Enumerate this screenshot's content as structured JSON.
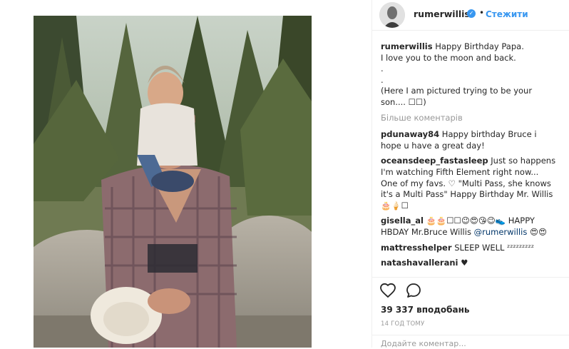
{
  "post": {
    "username": "rumerwillis",
    "verified_glyph": "✓",
    "separator": "•",
    "follow_label": "Стежити"
  },
  "caption": {
    "user": "rumerwillis",
    "text": "Happy Birthday Papa.\nI love you to the moon and back.\n.\n.\n(Here I am pictured trying to be your son.... ☐☐)"
  },
  "more_comments_label": "Більше коментарів",
  "comments": [
    {
      "user": "pdunaway84",
      "text": "Happy birthday Bruce i hope u have a great day!",
      "mention": ""
    },
    {
      "user": "oceansdeep_fastasleep",
      "text": "Just so happens I'm watching Fifth Element right now... One of my favs. ♡ \"Multi Pass, she knows it's a Multi Pass\" Happy Birthday Mr. Willis 🎂🍦☐",
      "mention": ""
    },
    {
      "user": "gisella_al",
      "text": "🎂🎂☐☐😉😍😘😉👟 HAPPY HBDAY Mr.Bruce Willis ",
      "mention": "@rumerwillis",
      "after": " 😍😍"
    },
    {
      "user": "mattresshelper",
      "text": "SLEEP WELL ᶻᶻᶻᶻᶻᶻᶻᶻᶻ",
      "mention": ""
    },
    {
      "user": "natashavallerani",
      "text": "♥",
      "mention": ""
    }
  ],
  "likes": "39 337 вподобань",
  "timestamp": "14 ГОД ТОМУ",
  "add_comment_placeholder": "Додайте коментар...",
  "icons": {
    "like": "heart-icon",
    "comment": "speech-bubble-icon",
    "verified": "verified-badge-icon"
  },
  "colors": {
    "link": "#3897f0",
    "muted": "#999999",
    "text": "#262626"
  }
}
